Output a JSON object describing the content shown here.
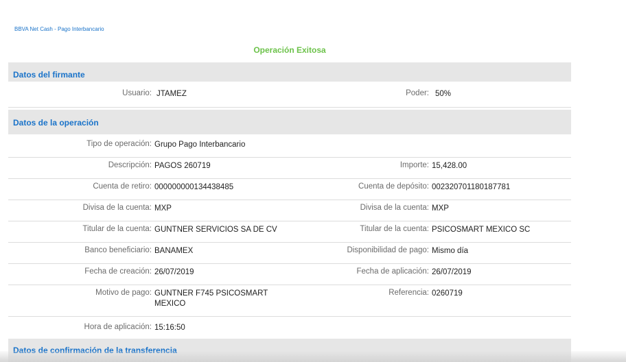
{
  "breadcrumb": "BBVA Net Cash - Pago Interbancario",
  "status": "Operación Exitosa",
  "signer_section": {
    "title": "Datos del firmante",
    "usuario_label": "Usuario:",
    "usuario_value": "JTAMEZ",
    "poder_label": "Poder:",
    "poder_value": "50%"
  },
  "operation_section": {
    "title": "Datos de la operación",
    "rows": [
      {
        "l1": "Tipo de operación:",
        "v1": "Grupo Pago Interbancario",
        "l2": "",
        "v2": ""
      },
      {
        "l1": "Descripción:",
        "v1": "PAGOS 260719",
        "l2": "Importe:",
        "v2": "15,428.00"
      },
      {
        "l1": "Cuenta de retiro:",
        "v1": "000000000134438485",
        "l2": "Cuenta de depósito:",
        "v2": "002320701180187781"
      },
      {
        "l1": "Divisa de la cuenta:",
        "v1": "MXP",
        "l2": "Divisa de la cuenta:",
        "v2": "MXP"
      },
      {
        "l1": "Titular de la cuenta:",
        "v1": "GUNTNER SERVICIOS SA DE CV",
        "l2": "Titular de la cuenta:",
        "v2": "PSICOSMART MEXICO SC"
      },
      {
        "l1": "Banco beneficiario:",
        "v1": "BANAMEX",
        "l2": "Disponibilidad de pago:",
        "v2": "Mismo día"
      },
      {
        "l1": "Fecha de creación:",
        "v1": "26/07/2019",
        "l2": "Fecha de aplicación:",
        "v2": "26/07/2019"
      },
      {
        "l1": "Motivo de pago:",
        "v1": "GUNTNER F745 PSICOSMART MEXICO",
        "l2": "Referencia:",
        "v2": "0260719"
      },
      {
        "l1": "Hora de aplicación:",
        "v1": "15:16:50",
        "l2": "",
        "v2": ""
      }
    ]
  },
  "confirmation_section": {
    "title": "Datos de confirmación de la transferencia"
  }
}
